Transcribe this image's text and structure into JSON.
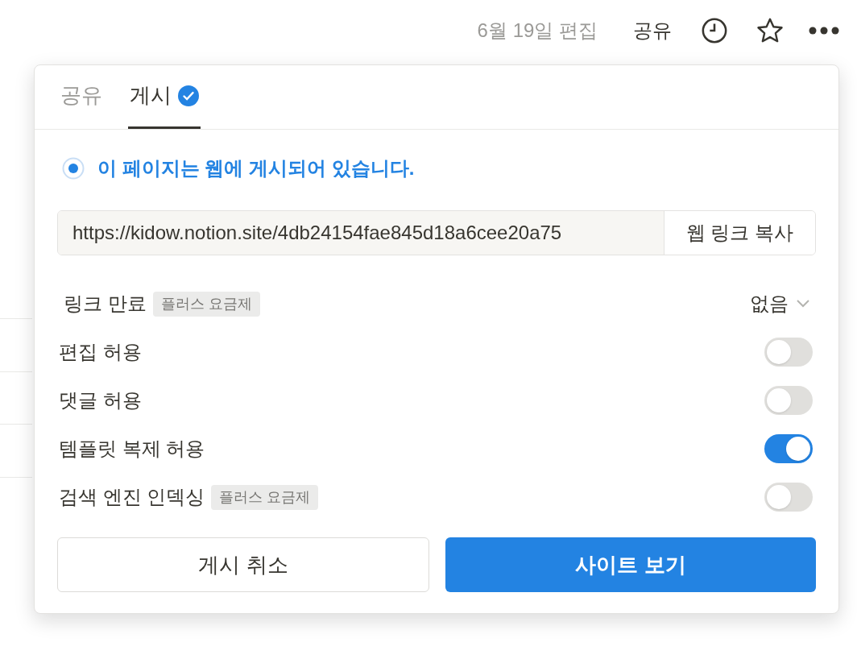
{
  "topbar": {
    "edited": "6월 19일 편집",
    "share": "공유"
  },
  "tabs": [
    {
      "label": "공유",
      "selected": false,
      "verified": false
    },
    {
      "label": "게시",
      "selected": true,
      "verified": true
    }
  ],
  "status": {
    "text": "이 페이지는 웹에 게시되어 있습니다.",
    "live": true
  },
  "link": {
    "value": "https://kidow.notion.site/4db24154fae845d18a6cee20a75",
    "copy_button": "웹 링크 복사"
  },
  "settings": [
    {
      "kind": "select",
      "label": "링크 만료",
      "badge": "플러스 요금제",
      "value": "없음"
    },
    {
      "kind": "toggle",
      "label": "편집 허용",
      "on": false
    },
    {
      "kind": "toggle",
      "label": "댓글 허용",
      "on": false
    },
    {
      "kind": "toggle",
      "label": "템플릿 복제 허용",
      "on": true
    },
    {
      "kind": "toggle",
      "label": "검색 엔진 인덱싱",
      "badge": "플러스 요금제",
      "on": false
    }
  ],
  "buttons": [
    {
      "kind": "secondary",
      "label": "게시 취소"
    },
    {
      "kind": "primary",
      "label": "사이트 보기"
    }
  ]
}
